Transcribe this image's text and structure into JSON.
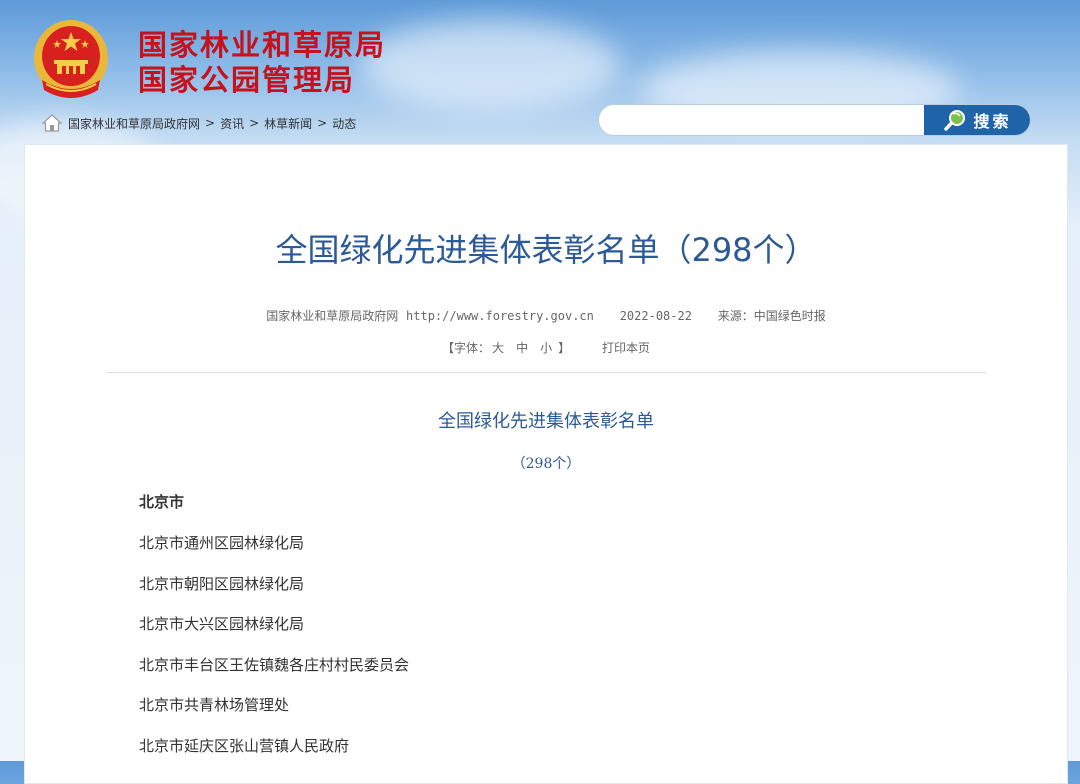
{
  "header": {
    "title_line1": "国家林业和草原局",
    "title_line2": "国家公园管理局"
  },
  "breadcrumb": {
    "items": [
      "国家林业和草原局政府网",
      "资讯",
      "林草新闻",
      "动态"
    ],
    "separator": ">"
  },
  "search": {
    "placeholder": "",
    "button_label": "搜索"
  },
  "article": {
    "title": "全国绿化先进集体表彰名单（298个）",
    "source_site": "国家林业和草原局政府网",
    "source_url": "http://www.forestry.gov.cn",
    "date": "2022-08-22",
    "origin_label": "来源：",
    "origin": "中国绿色时报",
    "font_size_prefix": "【字体：",
    "font_sizes": [
      "大",
      "中",
      "小"
    ],
    "font_size_suffix": "】",
    "print_label": "打印本页",
    "body_heading": "全国绿化先进集体表彰名单",
    "body_count": "（298个）",
    "region": "北京市",
    "orgs": [
      "北京市通州区园林绿化局",
      "北京市朝阳区园林绿化局",
      "北京市大兴区园林绿化局",
      "北京市丰台区王佐镇魏各庄村村民委员会",
      "北京市共青林场管理处",
      "北京市延庆区张山营镇人民政府"
    ]
  },
  "colors": {
    "title_red": "#c5121c",
    "article_blue": "#2b5a96",
    "search_button": "#1f63a9"
  },
  "icons": [
    "national-emblem-icon",
    "home-icon",
    "search-icon"
  ]
}
